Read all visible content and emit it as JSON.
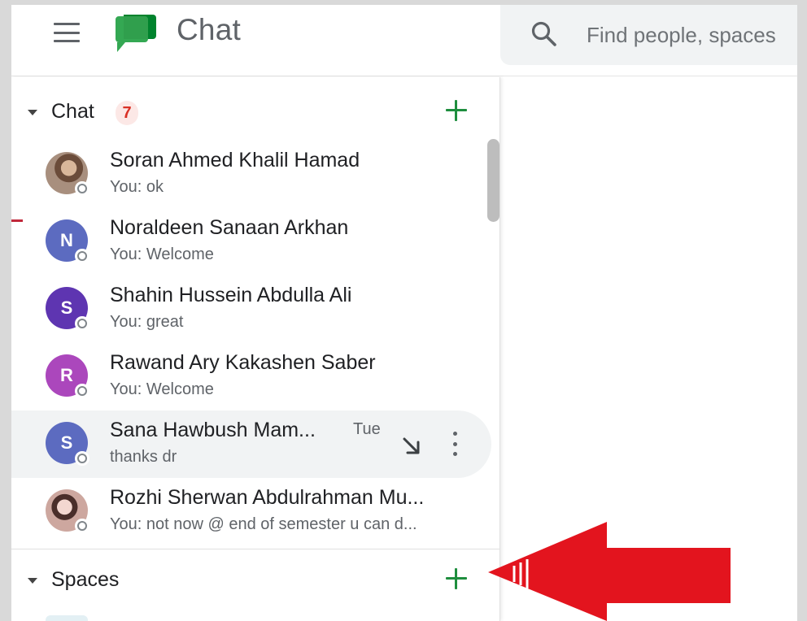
{
  "app": {
    "title": "Chat"
  },
  "search": {
    "placeholder": "Find people, spaces"
  },
  "chat_section": {
    "title": "Chat",
    "badge": "7",
    "items": [
      {
        "name": "Soran Ahmed Khalil Hamad",
        "snippet": "You: ok",
        "avatar": "",
        "avatar_color": "photo"
      },
      {
        "name": "Noraldeen Sanaan Arkhan",
        "snippet": "You: Welcome",
        "avatar": "N",
        "avatar_color": "#5c6bc0"
      },
      {
        "name": "Shahin Hussein Abdulla Ali",
        "snippet": "You: great",
        "avatar": "S",
        "avatar_color": "#5e35b1"
      },
      {
        "name": "Rawand Ary Kakashen Saber",
        "snippet": "You: Welcome",
        "avatar": "R",
        "avatar_color": "#ab47bc"
      },
      {
        "name": "Sana Hawbush Mam...",
        "snippet": "thanks dr",
        "avatar": "S",
        "avatar_color": "#5c6bc0",
        "time": "Tue"
      },
      {
        "name": "Rozhi Sherwan Abdulrahman Mu...",
        "snippet": "You: not now @ end of semester u can d...",
        "avatar": "",
        "avatar_color": "photo"
      }
    ]
  },
  "spaces_section": {
    "title": "Spaces"
  },
  "colors": {
    "accent_green": "#1e8e3e",
    "badge_red": "#d93025",
    "annotation_red": "#e3141e"
  }
}
